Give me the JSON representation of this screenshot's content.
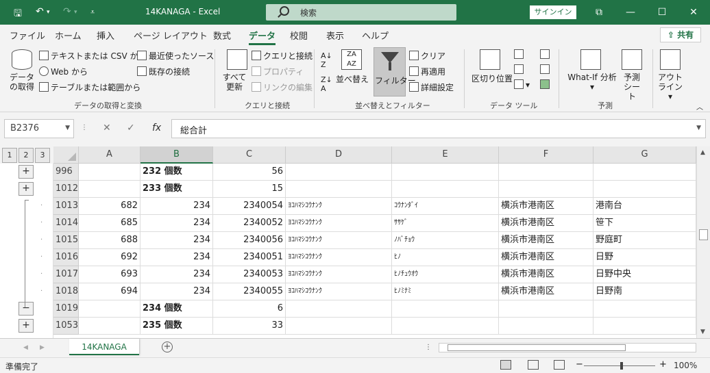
{
  "titlebar": {
    "title": "14KANAGA  -  Excel",
    "search": "検索",
    "signin": "サインイン"
  },
  "tabs": [
    "ファイル",
    "ホーム",
    "挿入",
    "ページ レイアウト",
    "数式",
    "データ",
    "校閲",
    "表示",
    "ヘルプ"
  ],
  "active_tab": "データ",
  "share": "共有",
  "ribbon": {
    "get_data": "データの取得",
    "text_csv": "テキストまたは CSV から",
    "web": "Web から",
    "table_range": "テーブルまたは範囲から",
    "recent": "最近使ったソース",
    "existing": "既存の接続",
    "group_get": "データの取得と変換",
    "refresh_all": "すべて更新",
    "queries": "クエリと接続",
    "properties": "プロパティ",
    "edit_links": "リンクの編集",
    "group_queries": "クエリと接続",
    "sort": "並べ替え",
    "filter": "フィルター",
    "clear": "クリア",
    "reapply": "再適用",
    "advanced": "詳細設定",
    "group_sort": "並べ替えとフィルター",
    "text_to_columns": "区切り位置",
    "group_tools": "データ ツール",
    "whatif": "What-If 分析",
    "forecast": "予測シート",
    "group_forecast": "予測",
    "outline": "アウトライン"
  },
  "formula_bar": {
    "name_box": "B2376",
    "fx": "fx",
    "formula": "総合計"
  },
  "outline_levels": [
    "1",
    "2",
    "3"
  ],
  "columns": [
    "A",
    "B",
    "C",
    "D",
    "E",
    "F",
    "G"
  ],
  "rows": [
    {
      "num": "996",
      "A": "",
      "B": "232 個数",
      "C": "56",
      "D": "",
      "E": "",
      "F": "",
      "G": "",
      "subtotal": true,
      "outline": "+"
    },
    {
      "num": "1012",
      "A": "",
      "B": "233 個数",
      "C": "15",
      "D": "",
      "E": "",
      "F": "",
      "G": "",
      "subtotal": true,
      "outline": "+"
    },
    {
      "num": "1013",
      "A": "682",
      "B": "234",
      "C": "2340054",
      "D": "ﾖｺﾊﾏｼｺｳﾅﾝｸ",
      "E": "ｺｳﾅﾝﾀﾞｲ",
      "F": "横浜市港南区",
      "G": "港南台",
      "subtotal": false,
      "outline": "·"
    },
    {
      "num": "1014",
      "A": "685",
      "B": "234",
      "C": "2340052",
      "D": "ﾖｺﾊﾏｼｺｳﾅﾝｸ",
      "E": "ｻｻｹﾞ",
      "F": "横浜市港南区",
      "G": "笹下",
      "subtotal": false,
      "outline": "·"
    },
    {
      "num": "1015",
      "A": "688",
      "B": "234",
      "C": "2340056",
      "D": "ﾖｺﾊﾏｼｺｳﾅﾝｸ",
      "E": "ﾉﾊﾞﾁｮｳ",
      "F": "横浜市港南区",
      "G": "野庭町",
      "subtotal": false,
      "outline": "·"
    },
    {
      "num": "1016",
      "A": "692",
      "B": "234",
      "C": "2340051",
      "D": "ﾖｺﾊﾏｼｺｳﾅﾝｸ",
      "E": "ﾋﾉ",
      "F": "横浜市港南区",
      "G": "日野",
      "subtotal": false,
      "outline": "·"
    },
    {
      "num": "1017",
      "A": "693",
      "B": "234",
      "C": "2340053",
      "D": "ﾖｺﾊﾏｼｺｳﾅﾝｸ",
      "E": "ﾋﾉﾁｭｳｵｳ",
      "F": "横浜市港南区",
      "G": "日野中央",
      "subtotal": false,
      "outline": "·"
    },
    {
      "num": "1018",
      "A": "694",
      "B": "234",
      "C": "2340055",
      "D": "ﾖｺﾊﾏｼｺｳﾅﾝｸ",
      "E": "ﾋﾉﾐﾅﾐ",
      "F": "横浜市港南区",
      "G": "日野南",
      "subtotal": false,
      "outline": "·"
    },
    {
      "num": "1019",
      "A": "",
      "B": "234 個数",
      "C": "6",
      "D": "",
      "E": "",
      "F": "",
      "G": "",
      "subtotal": true,
      "outline": "−"
    },
    {
      "num": "1053",
      "A": "",
      "B": "235 個数",
      "C": "33",
      "D": "",
      "E": "",
      "F": "",
      "G": "",
      "subtotal": true,
      "outline": "+"
    }
  ],
  "sheet_tab": "14KANAGA",
  "status": "準備完了",
  "zoom": "100%",
  "selected_column": "B"
}
